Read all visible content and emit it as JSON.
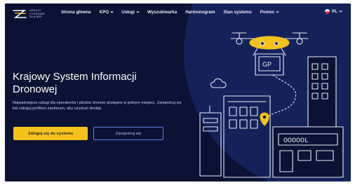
{
  "logo": {
    "lines": [
      "USŁUGI",
      "CYFROWE",
      "DLA BSP"
    ]
  },
  "nav": {
    "items": [
      {
        "label": "Strona główna",
        "dropdown": false
      },
      {
        "label": "KPO",
        "dropdown": true
      },
      {
        "label": "Usługi",
        "dropdown": true
      },
      {
        "label": "Wyszukiwarka",
        "dropdown": false
      },
      {
        "label": "Harmonogram",
        "dropdown": false
      },
      {
        "label": "Stan systemu",
        "dropdown": false
      },
      {
        "label": "Pomoc",
        "dropdown": true
      }
    ],
    "language": "PL"
  },
  "hero": {
    "title_line1": "Krajowy System Informacji",
    "title_line2": "Dronowej",
    "description": "Najważniejsze usługi dla operatorów i pilotów dronów dostępne w jednym miejscu. Zarejestruj się lub zaloguj profilem zaufanym, aby uzyskać dostęp.",
    "login_button": "Zaloguj się do systemu",
    "register_button": "Zarejestruj się"
  },
  "colors": {
    "background": "#0b1233",
    "accent_yellow": "#f5c21b",
    "outline_blue": "#5d7de0",
    "circle": "#14225a"
  },
  "illustration": {
    "building_sign": "OOOOOL",
    "drone_screen": "GP"
  }
}
